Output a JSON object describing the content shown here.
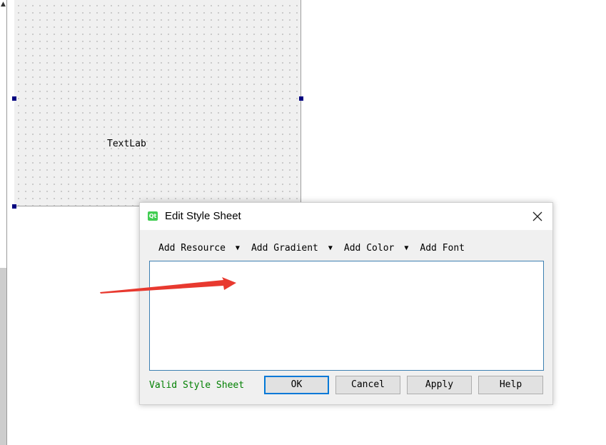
{
  "form": {
    "label_text": "TextLab"
  },
  "dialog": {
    "title": "Edit Style Sheet",
    "icon": "qt-logo-icon",
    "close_icon": "close-icon",
    "toolbar": {
      "add_resource": "Add Resource",
      "add_gradient": "Add Gradient",
      "add_color": "Add Color",
      "add_font": "Add Font"
    },
    "editor_text": "",
    "status": "Valid Style Sheet",
    "buttons": {
      "ok": "OK",
      "cancel": "Cancel",
      "apply": "Apply",
      "help": "Help"
    }
  },
  "colors": {
    "status_valid": "#008000",
    "annotation_arrow": "#e8392f",
    "selection_handle": "#000080",
    "qt_icon": "#41cd52"
  }
}
